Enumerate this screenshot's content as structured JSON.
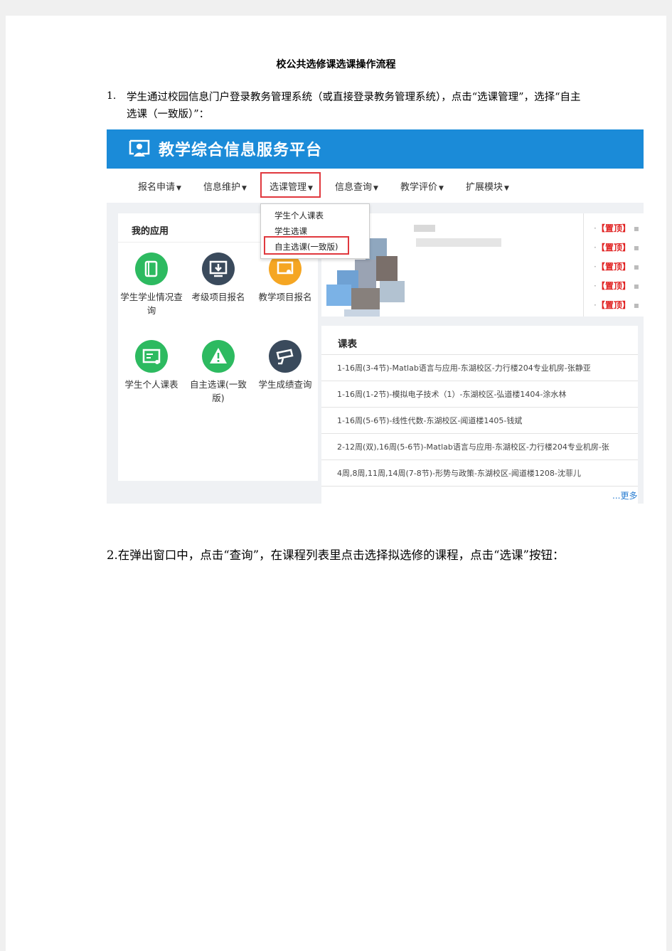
{
  "document": {
    "title": "校公共选修课选课操作流程",
    "step1": {
      "number": "1.",
      "text": "学生通过校园信息门户登录教务管理系统（或直接登录教务管理系统），点击“选课管理”，选择“自主选课（一致版）”："
    },
    "step2": {
      "text": "2.在弹出窗口中，点击“查询”，在课程列表里点击选择拟选修的课程，点击“选课”按钮："
    }
  },
  "screenshot": {
    "platform_title": "教学综合信息服务平台",
    "nav": [
      "报名申请",
      "信息维护",
      "选课管理",
      "信息查询",
      "教学评价",
      "扩展模块"
    ],
    "dropdown": [
      "学生个人课表",
      "学生选课",
      "自主选课(一致版)"
    ],
    "my_apps": {
      "title": "我的应用",
      "items": [
        {
          "label": "学生学业情况查询",
          "icon": "book-icon",
          "color": "#2dba60"
        },
        {
          "label": "考级项目报名",
          "icon": "download-icon",
          "color": "#3a4a5c"
        },
        {
          "label": "教学项目报名",
          "icon": "certificate-icon",
          "color": "#f5a623"
        },
        {
          "label": "学生个人课表",
          "icon": "schedule-icon",
          "color": "#2dba60"
        },
        {
          "label": "自主选课(一致版)",
          "icon": "warning-icon",
          "color": "#2dba60"
        },
        {
          "label": "学生成绩查询",
          "icon": "camera-icon",
          "color": "#3a4a5c"
        }
      ]
    },
    "notices": [
      {
        "tag": "【置顶】"
      },
      {
        "tag": "【置顶】"
      },
      {
        "tag": "【置顶】"
      },
      {
        "tag": "【置顶】"
      },
      {
        "tag": "【置顶】"
      }
    ],
    "schedule": {
      "title": "课表",
      "rows": [
        "1-16周(3-4节)-Matlab语言与应用-东湖校区-力行楼204专业机房-张静亚",
        "1-16周(1-2节)-模拟电子技术（1）-东湖校区-弘道楼1404-涂水林",
        "1-16周(5-6节)-线性代数-东湖校区-闻道楼1405-钱斌",
        "2-12周(双),16周(5-6节)-Matlab语言与应用-东湖校区-力行楼204专业机房-张",
        "4周,8周,11周,14周(7-8节)-形势与政策-东湖校区-闻道楼1208-沈菲儿"
      ],
      "more": "...更多"
    }
  }
}
